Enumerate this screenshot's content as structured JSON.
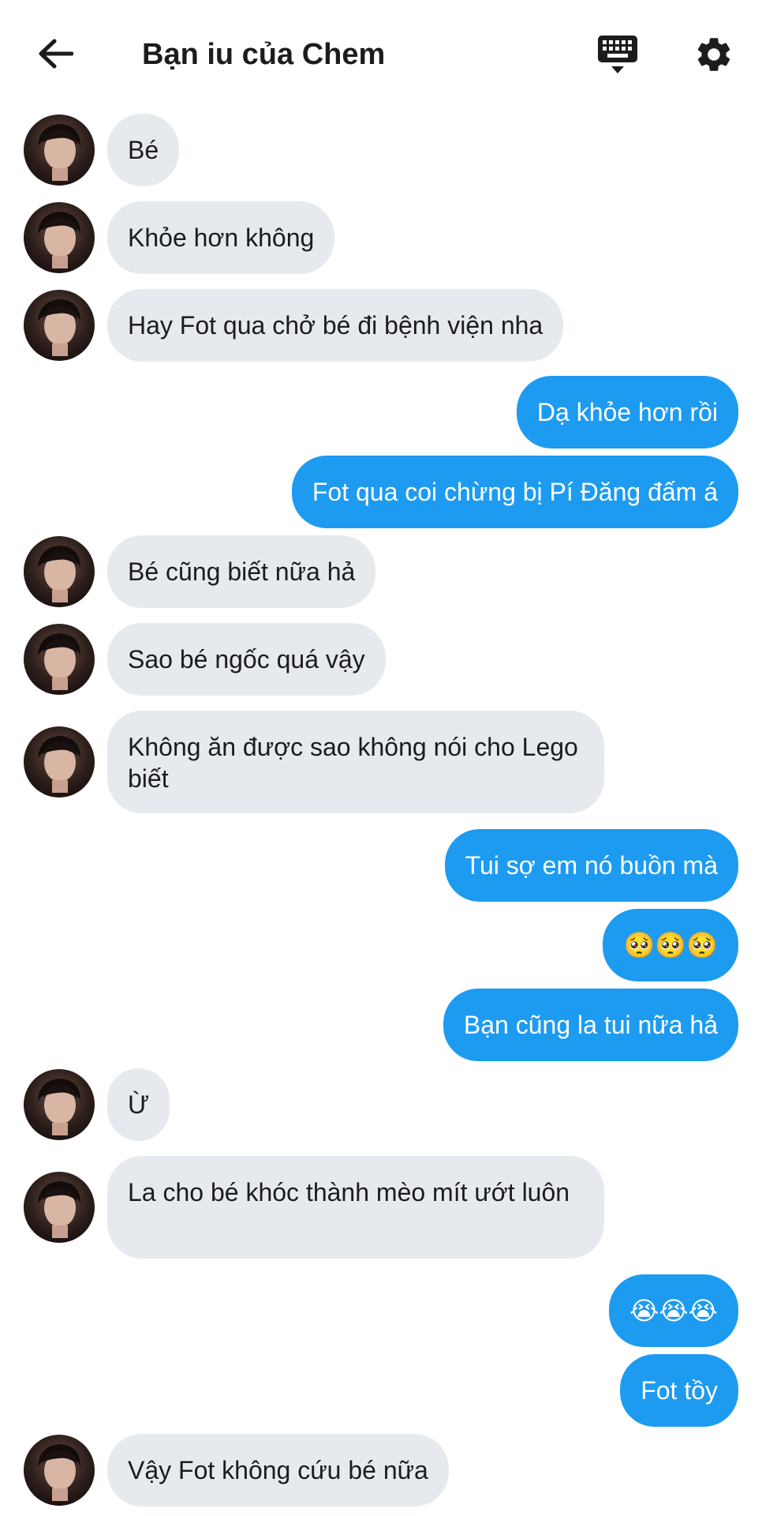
{
  "header": {
    "title": "Bạn iu của Chem",
    "back_icon": "arrow-left-icon",
    "keyboard_icon": "keyboard-icon",
    "settings_icon": "gear-icon"
  },
  "colors": {
    "incoming_bubble": "#e6eaee",
    "outgoing_bubble": "#1d9bf0",
    "text_dark": "#1c1c1e"
  },
  "messages": [
    {
      "side": "in",
      "text": "Bé"
    },
    {
      "side": "in",
      "text": "Khỏe hơn không"
    },
    {
      "side": "in",
      "text": "Hay Fot qua chở bé đi bệnh viện nha"
    },
    {
      "side": "out",
      "text": "Dạ khỏe hơn rồi"
    },
    {
      "side": "out",
      "text": "Fot qua coi chừng bị Pí Đăng đấm á"
    },
    {
      "side": "in",
      "text": "Bé cũng biết nữa hả"
    },
    {
      "side": "in",
      "text": "Sao bé ngốc quá vậy"
    },
    {
      "side": "in",
      "text": "Không ăn được sao không nói cho Lego biết"
    },
    {
      "side": "out",
      "text": "Tui sợ em nó buồn mà"
    },
    {
      "side": "out",
      "text": "🥺🥺🥺"
    },
    {
      "side": "out",
      "text": "Bạn cũng la tui nữa hả"
    },
    {
      "side": "in",
      "text": "Ừ"
    },
    {
      "side": "in",
      "text": "La cho bé khóc thành mèo mít ướt luôn"
    },
    {
      "side": "out",
      "text": "😭😭😭"
    },
    {
      "side": "out",
      "text": "Fot tồy"
    },
    {
      "side": "in",
      "text": "Vậy Fot không cứu bé nữa"
    }
  ]
}
